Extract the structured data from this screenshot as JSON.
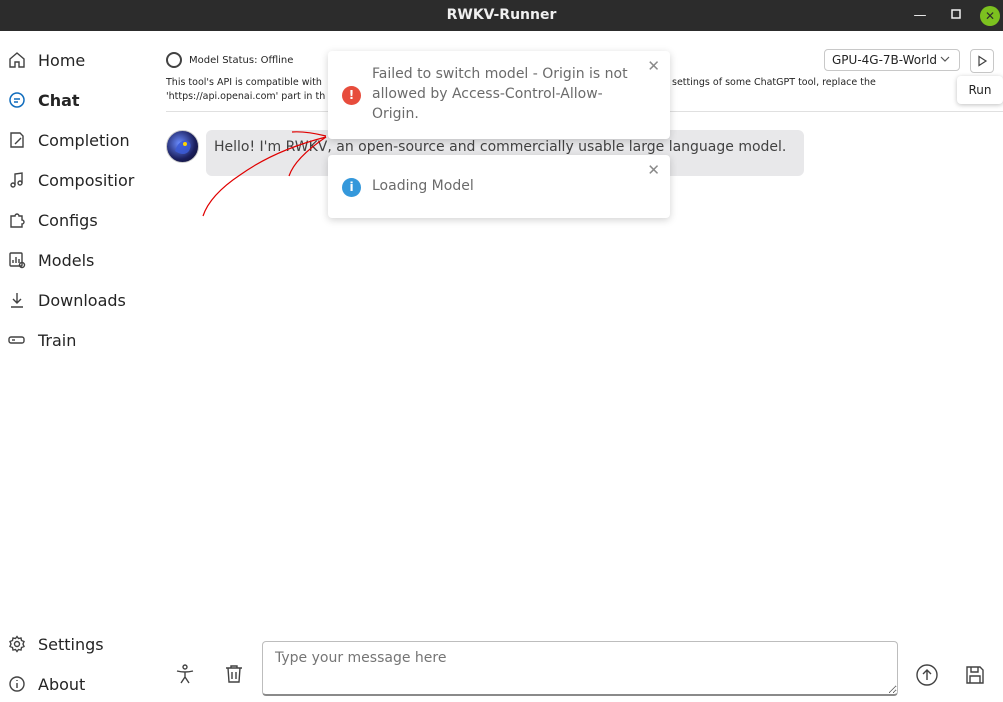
{
  "window": {
    "title": "RWKV-Runner",
    "minimize_icon": "minimize-icon",
    "maximize_icon": "maximize-icon",
    "close_icon": "close-icon",
    "close_color": "#7cc11f"
  },
  "sidebar": {
    "items": [
      {
        "label": "Home",
        "icon": "home-icon"
      },
      {
        "label": "Chat",
        "icon": "chat-icon",
        "active": true
      },
      {
        "label": "Completion",
        "icon": "completion-icon"
      },
      {
        "label": "Compositior",
        "icon": "music-note-icon"
      },
      {
        "label": "Configs",
        "icon": "puzzle-icon"
      },
      {
        "label": "Models",
        "icon": "data-usage-icon"
      },
      {
        "label": "Downloads",
        "icon": "download-icon"
      },
      {
        "label": "Train",
        "icon": "train-icon"
      }
    ],
    "bottom": [
      {
        "label": "Settings",
        "icon": "settings-icon"
      },
      {
        "label": "About",
        "icon": "info-icon"
      }
    ]
  },
  "header": {
    "status_label": "Model Status: Offline",
    "api_note_1": "This tool's API is compatible with",
    "api_note_1b": "settings of some ChatGPT tool, replace the",
    "api_note_2": "'https://api.openai.com' part in th",
    "model_select": "GPU-4G-7B-World",
    "run_tooltip": "Run",
    "accent": "#0f6cbd"
  },
  "chat": {
    "messages": [
      {
        "sender": "assistant",
        "text": "Hello! I'm RWKV, an open-source and commercially usable large language model."
      }
    ],
    "input_placeholder": "Type your message here"
  },
  "toasts": [
    {
      "type": "error",
      "text": "Failed to switch model - Origin is not allowed by Access-Control-Allow-Origin.",
      "color": "#e74c3c"
    },
    {
      "type": "info",
      "text": "Loading Model",
      "color": "#3498db"
    }
  ],
  "annotation": {
    "color": "#e00000"
  }
}
